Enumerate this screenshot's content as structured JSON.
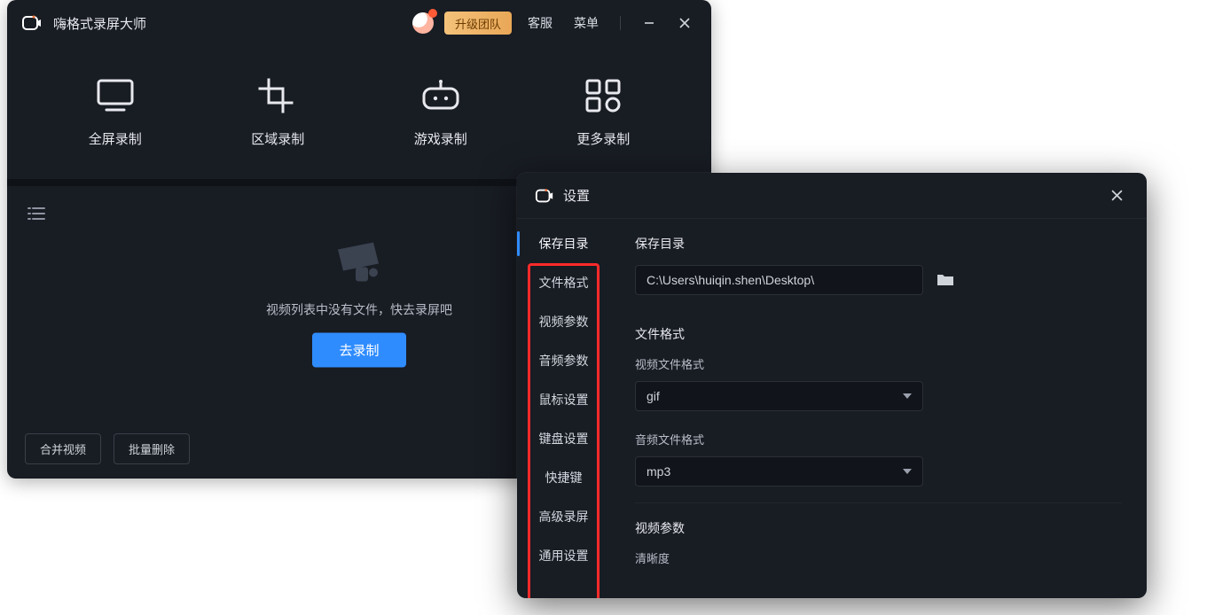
{
  "app": {
    "title": "嗨格式录屏大师",
    "upgrade": "升级团队",
    "support": "客服",
    "menu": "菜单"
  },
  "modes": {
    "fullscreen": "全屏录制",
    "region": "区域录制",
    "game": "游戏录制",
    "more": "更多录制"
  },
  "empty": {
    "message": "视频列表中没有文件，快去录屏吧",
    "go_record": "去录制"
  },
  "footer": {
    "merge": "合并视频",
    "batch_delete": "批量删除"
  },
  "settings": {
    "title": "设置",
    "nav": {
      "save_dir": "保存目录",
      "file_format": "文件格式",
      "video_params": "视频参数",
      "audio_params": "音频参数",
      "mouse": "鼠标设置",
      "keyboard": "键盘设置",
      "hotkeys": "快捷键",
      "advanced": "高级录屏",
      "general": "通用设置"
    },
    "save_dir": {
      "title": "保存目录",
      "path": "C:\\Users\\huiqin.shen\\Desktop\\"
    },
    "file_format": {
      "title": "文件格式",
      "video_label": "视频文件格式",
      "video_value": "gif",
      "audio_label": "音频文件格式",
      "audio_value": "mp3"
    },
    "video_params": {
      "title": "视频参数",
      "quality_label": "清晰度"
    }
  }
}
